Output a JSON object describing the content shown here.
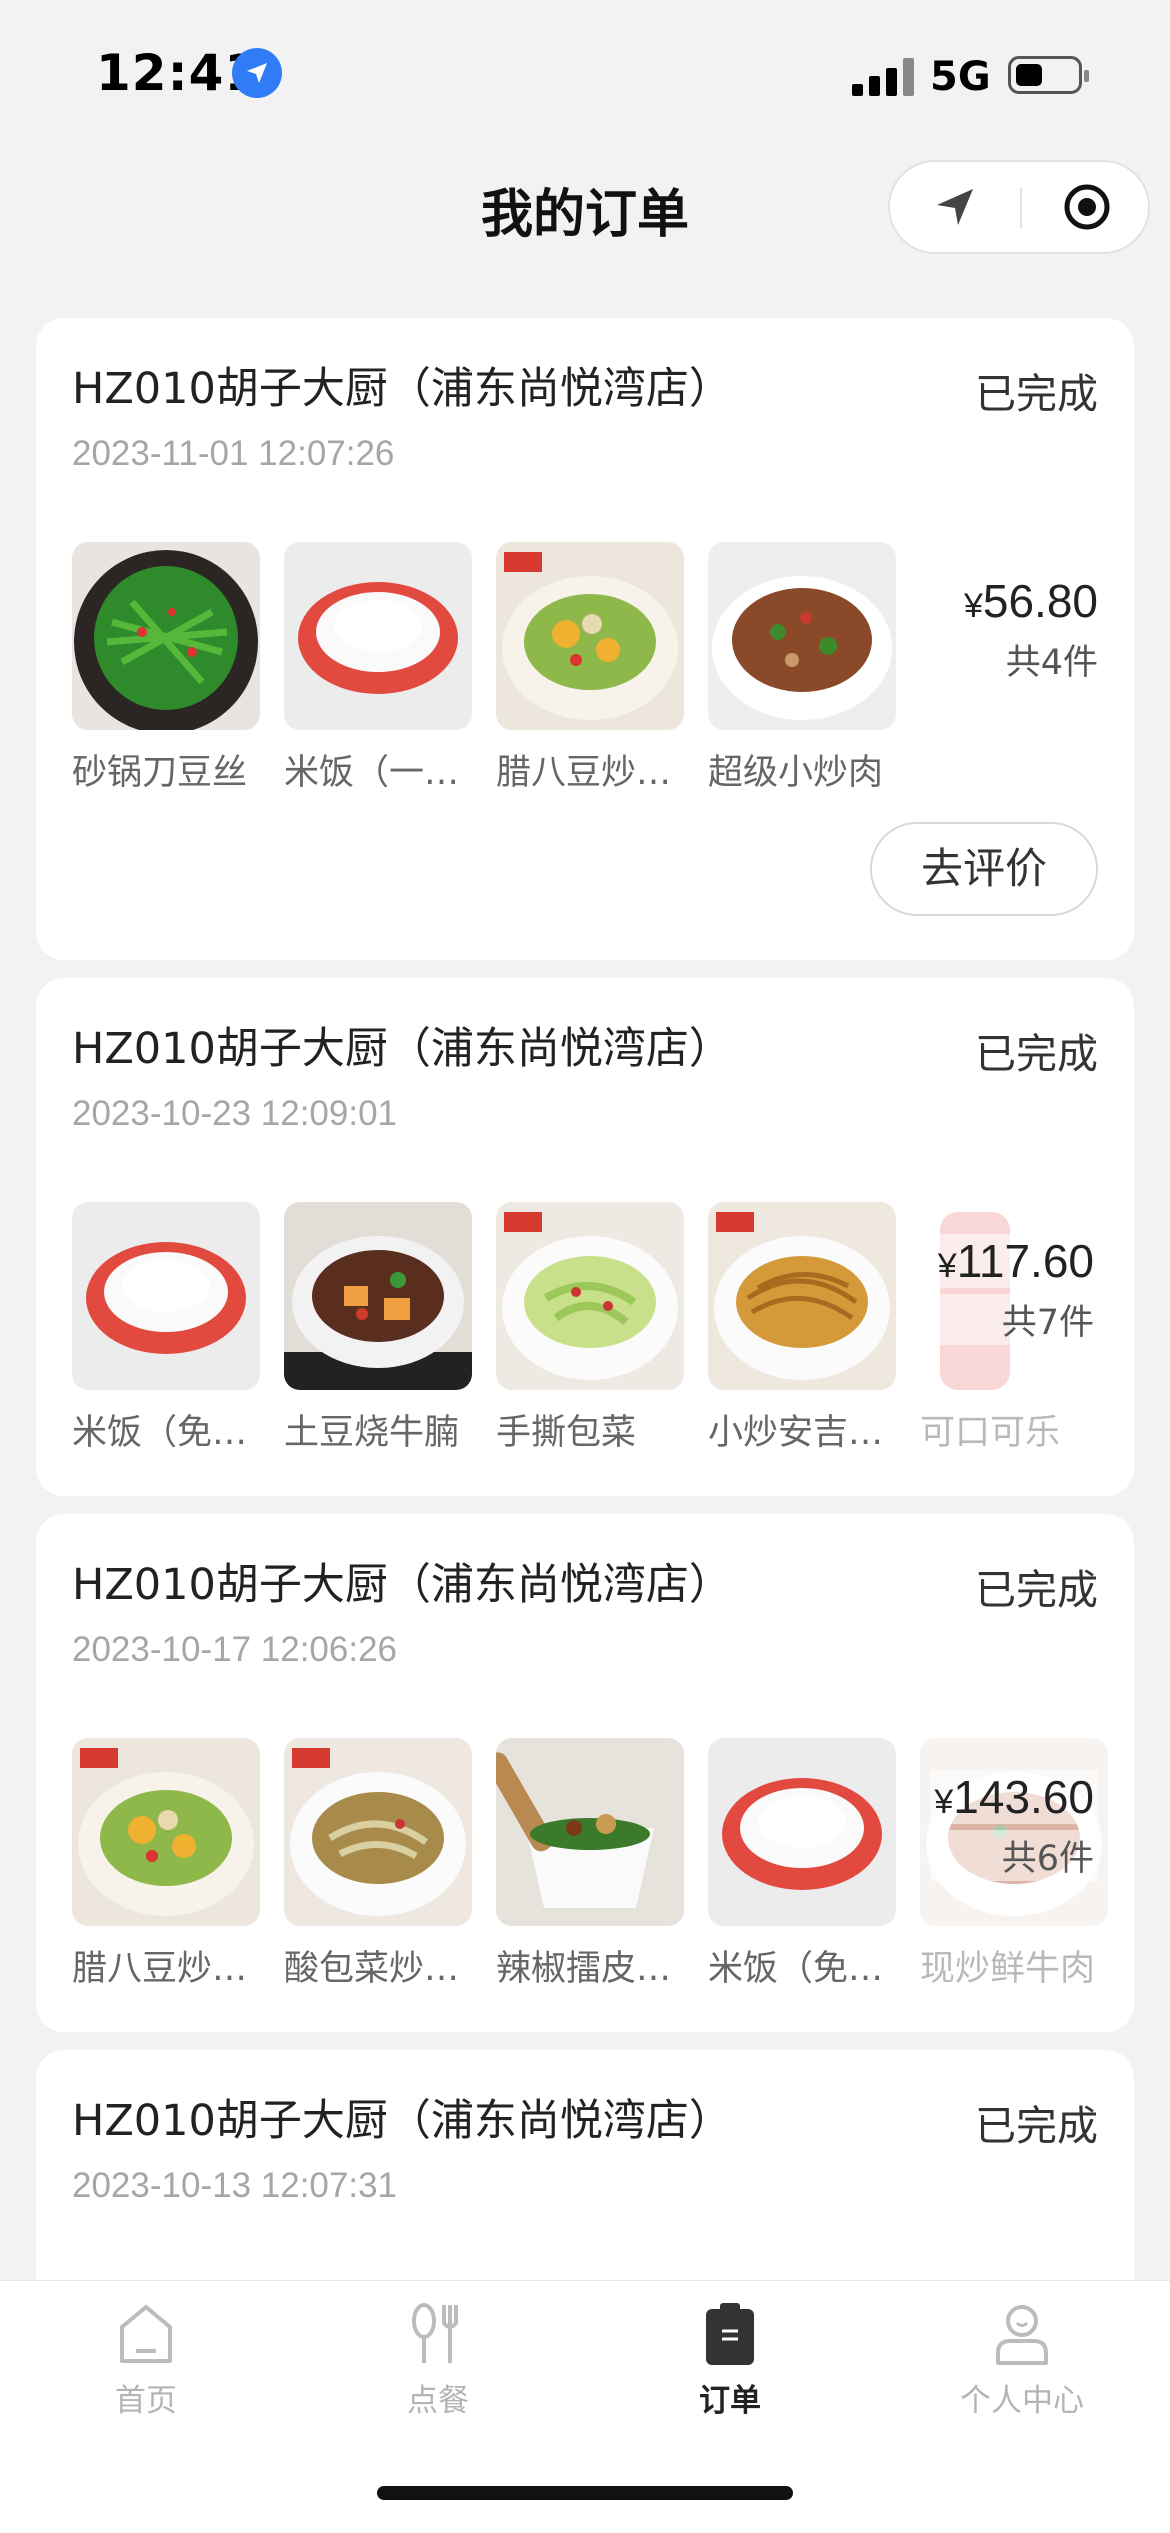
{
  "status_bar": {
    "time": "12:41",
    "network": "5G"
  },
  "header": {
    "title": "我的订单"
  },
  "orders": [
    {
      "store": "HZ010胡子大厨（浦东尚悦湾店）",
      "status": "已完成",
      "date": "2023-11-01 12:07:26",
      "currency": "¥",
      "amount": "56.80",
      "count": "共4件",
      "items": [
        "砂锅刀豆丝",
        "米饭（一…",
        "腊八豆炒…",
        "超级小炒肉"
      ],
      "action": "去评价"
    },
    {
      "store": "HZ010胡子大厨（浦东尚悦湾店）",
      "status": "已完成",
      "date": "2023-10-23 12:09:01",
      "currency": "¥",
      "amount": "117.60",
      "count": "共7件",
      "items": [
        "米饭（免…",
        "土豆烧牛腩",
        "手撕包菜",
        "小炒安吉…",
        "可口可乐"
      ]
    },
    {
      "store": "HZ010胡子大厨（浦东尚悦湾店）",
      "status": "已完成",
      "date": "2023-10-17 12:06:26",
      "currency": "¥",
      "amount": "143.60",
      "count": "共6件",
      "items": [
        "腊八豆炒…",
        "酸包菜炒…",
        "辣椒擂皮…",
        "米饭（免…",
        "现炒鲜牛肉"
      ]
    },
    {
      "store": "HZ010胡子大厨（浦东尚悦湾店）",
      "status": "已完成",
      "date": "2023-10-13 12:07:31"
    }
  ],
  "tabbar": {
    "tabs": [
      {
        "label": "首页",
        "icon": "home-icon"
      },
      {
        "label": "点餐",
        "icon": "utensils-icon"
      },
      {
        "label": "订单",
        "icon": "clipboard-icon",
        "active": true
      },
      {
        "label": "个人中心",
        "icon": "person-icon"
      }
    ]
  }
}
